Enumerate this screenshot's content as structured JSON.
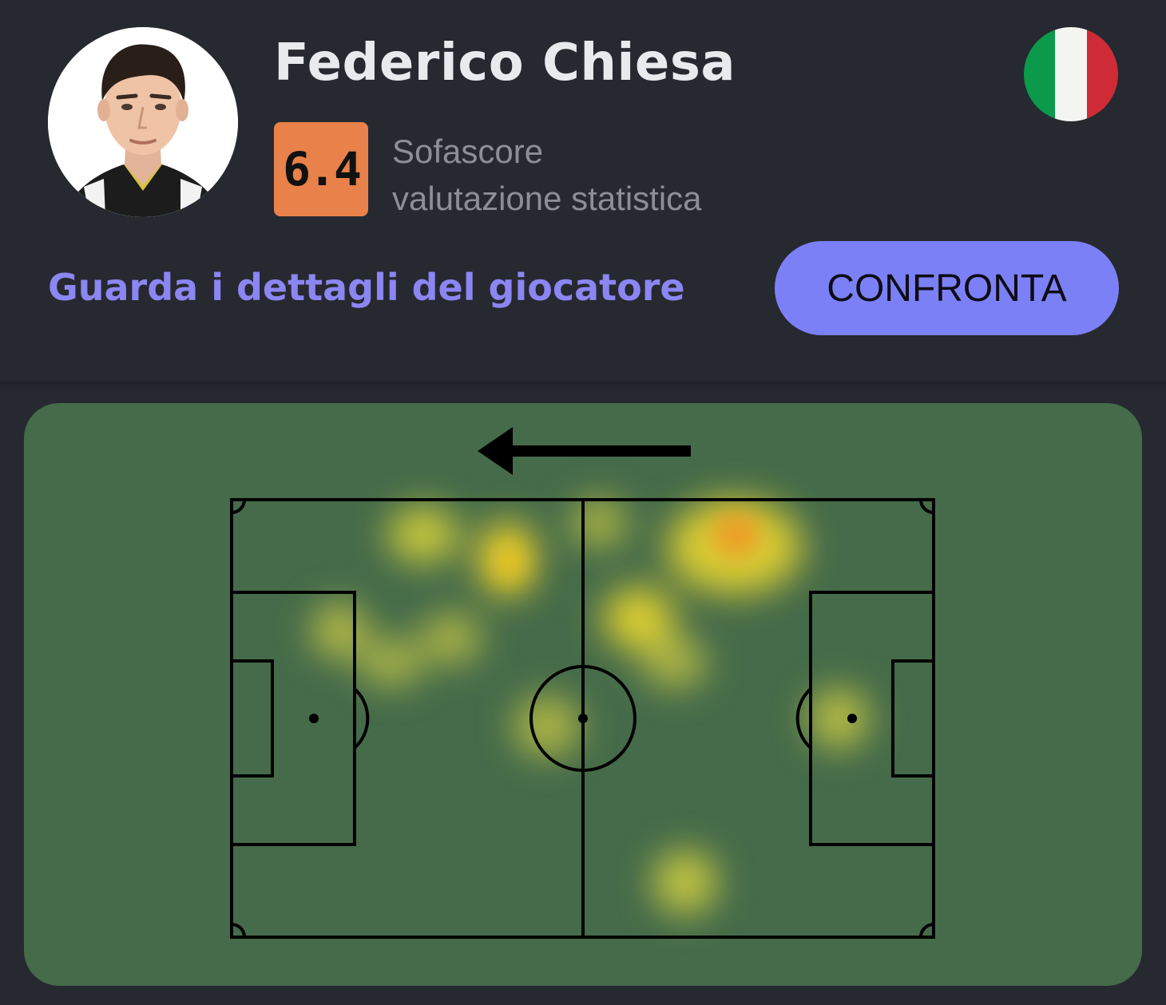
{
  "player": {
    "name": "Federico Chiesa",
    "rating": "6.4",
    "rating_label_line1": "Sofascore",
    "rating_label_line2": "valutazione statistica",
    "nationality_flag": "flag-italy-icon"
  },
  "actions": {
    "details_link": "Guarda i dettagli del giocatore",
    "compare_button": "CONFRONTA"
  },
  "heatmap": {
    "attack_direction": "left",
    "pitch_color": "#456b4a"
  },
  "colors": {
    "background": "#262930",
    "rating_badge": "#e8814a",
    "link": "#8b86f2",
    "button": "#7c80f7",
    "flag_green": "#0b9a4b",
    "flag_white": "#f4f5f0",
    "flag_red": "#cf2b37"
  }
}
